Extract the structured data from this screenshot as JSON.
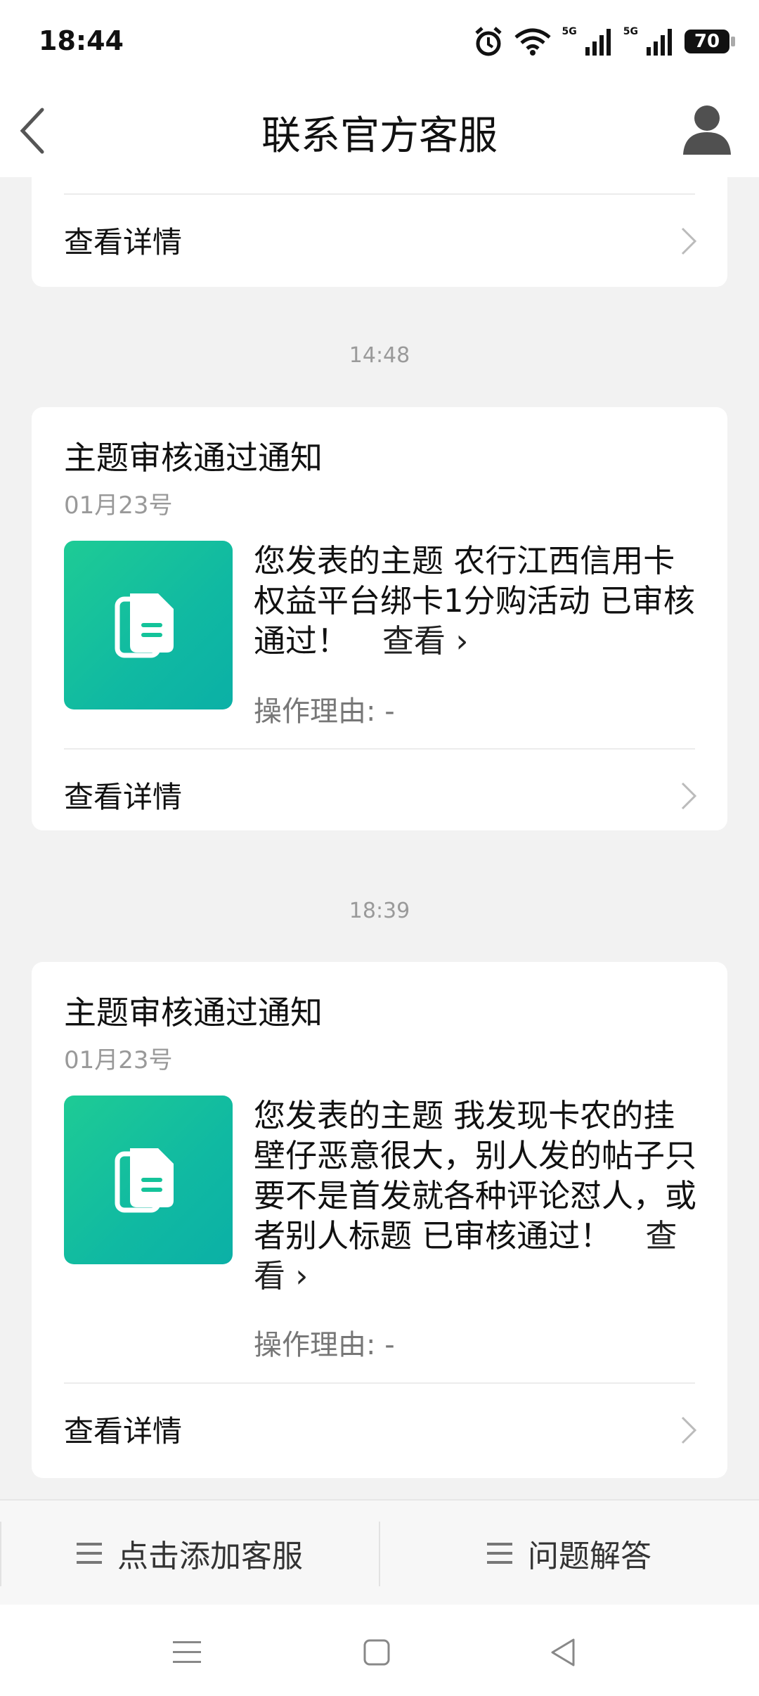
{
  "status": {
    "time": "18:44",
    "battery": "70",
    "net_label": "5G"
  },
  "header": {
    "title": "联系官方客服"
  },
  "cards": [
    {
      "details_label": "查看详情"
    },
    {
      "title": "主题审核通过通知",
      "date": "01月23号",
      "body": "您发表的主题 农行江西信用卡权益平台绑卡1分购活动 已审核通过！",
      "view_link": "查看 ›",
      "reason": "操作理由: -",
      "details_label": "查看详情"
    },
    {
      "title": "主题审核通过通知",
      "date": "01月23号",
      "body": "您发表的主题 我发现卡农的挂壁仔恶意很大，别人发的帖子只要不是首发就各种评论怼人，或者别人标题 已审核通过！",
      "view_link": "查看 ›",
      "reason": "操作理由: -",
      "details_label": "查看详情"
    }
  ],
  "timestamps": [
    "14:48",
    "18:39"
  ],
  "bottom_menu": {
    "left": "点击添加客服",
    "right": "问题解答"
  },
  "icons": {
    "back": "back-chevron-icon",
    "avatar": "user-avatar-icon",
    "doc": "document-icon",
    "menu": "menu-lines-icon",
    "chevron": "chevron-right-icon"
  },
  "colors": {
    "accent": "#14c39a",
    "background": "#f2f2f2",
    "card": "#ffffff"
  }
}
